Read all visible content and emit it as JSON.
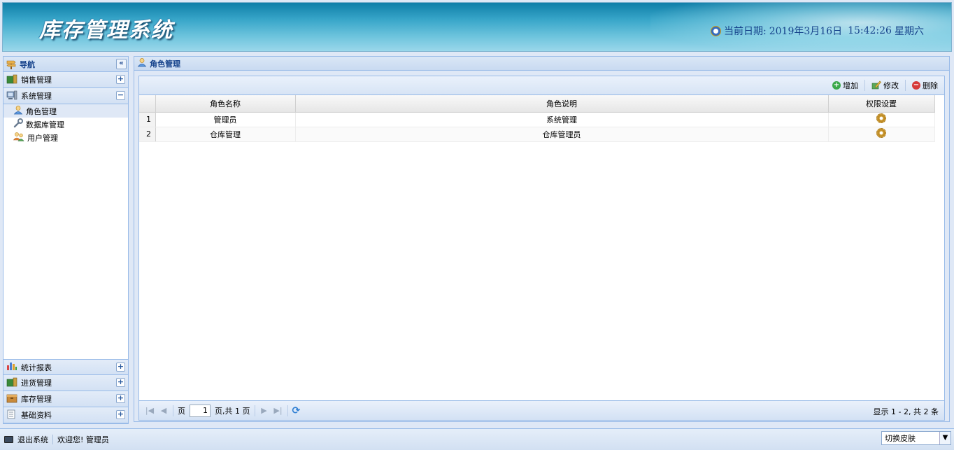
{
  "header": {
    "app_title": "库存管理系统",
    "date_label": "当前日期:",
    "date_value": "2019年3月16日",
    "time_value": "15:42:26",
    "weekday": "星期六"
  },
  "nav": {
    "title": "导航",
    "collapse_symbol": "«",
    "sections": [
      {
        "label": "销售管理",
        "expanded": false
      },
      {
        "label": "系统管理",
        "expanded": true,
        "items": [
          {
            "label": "角色管理",
            "active": true
          },
          {
            "label": "数据库管理",
            "active": false
          },
          {
            "label": "用户管理",
            "active": false
          }
        ]
      },
      {
        "label": "统计报表",
        "expanded": false
      },
      {
        "label": "进货管理",
        "expanded": false
      },
      {
        "label": "库存管理",
        "expanded": false
      },
      {
        "label": "基础资料",
        "expanded": false
      }
    ],
    "plus_symbol": "+",
    "minus_symbol": "−"
  },
  "main": {
    "tab_title": "角色管理",
    "toolbar": {
      "add": "增加",
      "edit": "修改",
      "delete": "删除"
    },
    "columns": [
      "角色名称",
      "角色说明",
      "权限设置"
    ],
    "rows": [
      {
        "num": "1",
        "name": "管理员",
        "desc": "系统管理"
      },
      {
        "num": "2",
        "name": "仓库管理",
        "desc": "仓库管理员"
      }
    ],
    "pager": {
      "page_label": "页",
      "page_value": "1",
      "total_label": "页,共 1 页",
      "info": "显示 1 - 2, 共 2 条"
    }
  },
  "status": {
    "logout": "退出系统",
    "welcome": "欢迎您! 管理员",
    "skin_select": "切换皮肤"
  },
  "colors": {
    "accent": "#15428b",
    "border": "#99bbe8",
    "panel_bg": "#dfe8f6"
  }
}
